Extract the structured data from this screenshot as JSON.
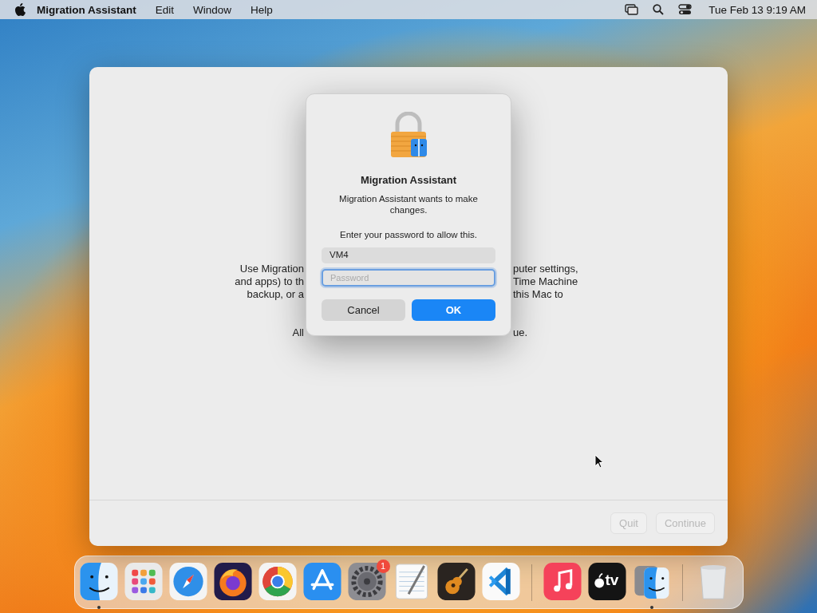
{
  "menu_bar": {
    "app_name": "Migration Assistant",
    "menus": [
      "Edit",
      "Window",
      "Help"
    ],
    "clock": "Tue Feb 13  9:19 AM"
  },
  "window": {
    "text_rows": [
      {
        "left": "Use Migration",
        "right": "puter settings,"
      },
      {
        "left": "and apps) to th",
        "right": "Time Machine"
      },
      {
        "left": "backup, or a",
        "right": "this Mac to"
      },
      {
        "left": "All",
        "right": "ue."
      }
    ],
    "buttons": [
      {
        "label": "Quit",
        "disabled": true
      },
      {
        "label": "Continue",
        "disabled": true
      }
    ]
  },
  "dialog": {
    "title": "Migration Assistant",
    "message": "Migration Assistant wants to make changes.",
    "prompt": "Enter your password to allow this.",
    "username": "VM4",
    "password": {
      "placeholder": "Password",
      "focused": true
    },
    "buttons": [
      {
        "label": "Cancel",
        "default": false
      },
      {
        "label": "OK",
        "default": true
      }
    ]
  },
  "dock": {
    "items": [
      {
        "running": true
      },
      {
        "running": false
      },
      {
        "running": false
      },
      {
        "running": false
      },
      {
        "running": false
      },
      {
        "running": false
      },
      {
        "running": false,
        "badge": "1"
      },
      {
        "running": false
      },
      {
        "running": false
      },
      {
        "running": false
      },
      {
        "running": false
      },
      {
        "running": false,
        "label": "tv"
      },
      {
        "running": true
      },
      {
        "running": false
      }
    ]
  }
}
